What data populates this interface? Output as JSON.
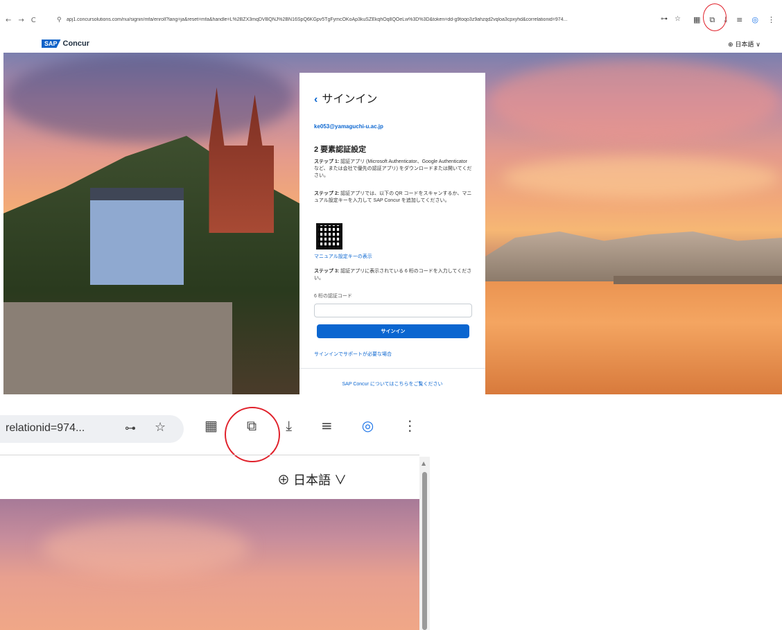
{
  "browser": {
    "nav_back": "←",
    "nav_forward": "→",
    "nav_reload": "C",
    "url": "apj1.concursolutions.com/nui/signin/mfa/enroll?lang=ja&reset=mfa&handle=L%2BZX3mqDVBQNJ%2BN16SpQ6KGpv5TgFymcOKoAp3kuSZEkqhOq8QOeLw%3D%3D&token=dd-g9toqo3z9ahzqd2vqloa3cpxyhd&correlationid=974...",
    "toolbar_icons": [
      "key-icon",
      "star-icon",
      "qr-icon",
      "extensions-icon",
      "download-icon",
      "media-icon",
      "profile-icon",
      "menu-icon"
    ]
  },
  "header": {
    "logo_sap": "SAP",
    "logo_concur": "Concur",
    "language": "⊕ 日本語 ∨"
  },
  "card": {
    "back_title": "サインイン",
    "email": "ke053@yamaguchi-u.ac.jp",
    "heading": "2 要素認証設定",
    "step1_label": "ステップ 1:",
    "step1_text": " 認証アプリ (Microsoft Authenticator、Google Authenticator など、または会社で優先の認証アプリ) をダウンロードまたは開いてください。",
    "step2_label": "ステップ 2:",
    "step2_text": " 認証アプリでは、以下の QR コードをスキャンするか、マニュアル設定キーを入力して SAP Concur を追加してください。",
    "manual_key_link": "マニュアル設定キーの表示",
    "step3_label": "ステップ 3:",
    "step3_text": " 認証アプリに表示されている 6 桁のコードを入力してください。",
    "code_label": "6 桁の認証コード",
    "code_value": "",
    "signin_button": "サインイン",
    "help_link": "サインインでサポートが必要な場合",
    "about_link": "SAP Concur についてはこちらをご覧ください"
  },
  "zoom": {
    "url_fragment": "relationid=974...",
    "language": "⊕ 日本語 ∨"
  },
  "colors": {
    "accent": "#0b66d0",
    "highlight_circle": "#e0202a"
  }
}
